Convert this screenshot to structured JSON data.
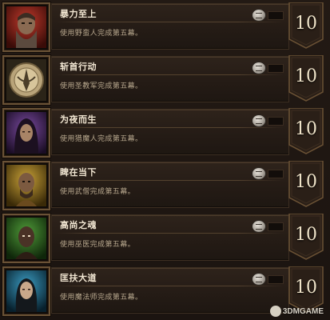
{
  "achievements": [
    {
      "title": "暴力至上",
      "description": "使用野蛮人完成第五幕。",
      "points": "10",
      "portrait": "barbarian-portrait",
      "accent": "#b0312a"
    },
    {
      "title": "斩首行动",
      "description": "使用圣教军完成第五幕。",
      "points": "10",
      "portrait": "crusader-emblem",
      "accent": "#c8b489"
    },
    {
      "title": "为夜而生",
      "description": "使用猎魔人完成第五幕。",
      "points": "10",
      "portrait": "demon-hunter-portrait",
      "accent": "#6b3a8c"
    },
    {
      "title": "睥在当下",
      "description": "使用武僧完成第五幕。",
      "points": "10",
      "portrait": "monk-portrait",
      "accent": "#b8932e"
    },
    {
      "title": "高尚之魂",
      "description": "使用巫医完成第五幕。",
      "points": "10",
      "portrait": "witch-doctor-portrait",
      "accent": "#3f7a2c"
    },
    {
      "title": "匡扶大道",
      "description": "使用魔法师完成第五幕。",
      "points": "10",
      "portrait": "wizard-portrait",
      "accent": "#2a7a9a"
    }
  ],
  "reward_icon": "banner-reward-icon",
  "watermark": {
    "text": "3DMGAME",
    "icon": "3dm-logo-icon"
  }
}
